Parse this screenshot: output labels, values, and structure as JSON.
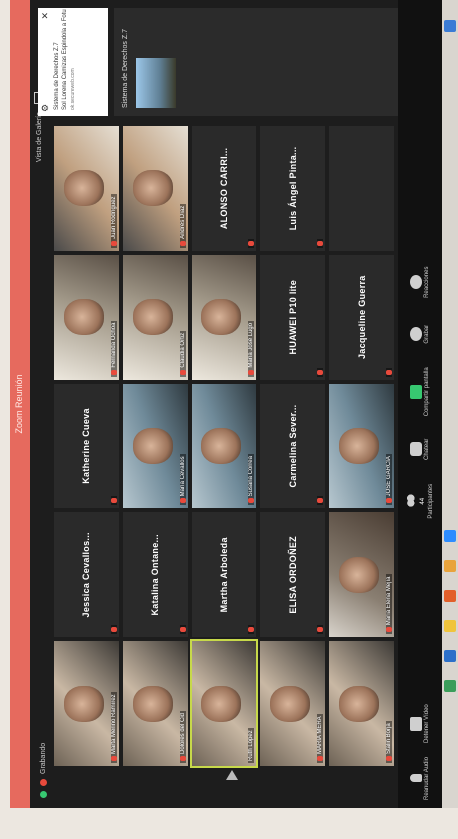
{
  "window": {
    "title": "Zoom Reunión"
  },
  "top": {
    "recording_label": "Grabando",
    "gallery_label": "Vista de Galería"
  },
  "participants": [
    {
      "name": "Marta Merino Ramírez",
      "type": "video",
      "muted": true
    },
    {
      "name": "Jessica Cevallos...",
      "type": "name",
      "muted": true
    },
    {
      "name": "Katherine Cueva",
      "type": "name",
      "muted": true
    },
    {
      "name": "Fernanda Ochoa",
      "type": "video",
      "muted": true
    },
    {
      "name": "Juan Rodríguez",
      "type": "video",
      "muted": true
    },
    {
      "name": "Dolores del Cid",
      "type": "video",
      "muted": true
    },
    {
      "name": "Katalina Ontane...",
      "type": "name",
      "muted": true
    },
    {
      "name": "María Cevallos",
      "type": "video",
      "muted": true
    },
    {
      "name": "Claudia Ortiz",
      "type": "video",
      "muted": true
    },
    {
      "name": "Andrés Díaz",
      "type": "video",
      "muted": true
    },
    {
      "name": "Ruth López",
      "type": "video",
      "muted": false,
      "active": true
    },
    {
      "name": "Martha Arboleda",
      "type": "name",
      "muted": true
    },
    {
      "name": "Susana Correa",
      "type": "video",
      "muted": true
    },
    {
      "name": "María José Lugo",
      "type": "video",
      "muted": true
    },
    {
      "name": "ALONSO CARRI...",
      "type": "name",
      "muted": true
    },
    {
      "name": "MARÍA MERA",
      "type": "video",
      "muted": true
    },
    {
      "name": "ELISA ORDOÑEZ",
      "type": "name",
      "muted": true
    },
    {
      "name": "Carmelina Sever...",
      "type": "name",
      "muted": true
    },
    {
      "name": "HUAWEI P10 lite",
      "type": "name",
      "muted": true
    },
    {
      "name": "Luis Ángel Pinta...",
      "type": "name",
      "muted": true
    },
    {
      "name": "Stalin Borja",
      "type": "video",
      "muted": true
    },
    {
      "name": "María Elena Mejía",
      "type": "video",
      "muted": true
    },
    {
      "name": "JOSÉ GARCÍA",
      "type": "video",
      "muted": true
    },
    {
      "name": "Jacqueline Guerra",
      "type": "name",
      "muted": true
    },
    {
      "name": "",
      "type": "empty",
      "muted": false
    }
  ],
  "notification": {
    "line1": "Sistema de Derechos Z.7",
    "line2": "Sol Lorena Camizas Espindola a Fotu",
    "line3": "ok.secureweb.com"
  },
  "chat": {
    "title": "Sistema de Derechos Z.7"
  },
  "toolbar": {
    "audio": "Reanudar Audio",
    "video": "Detener Vídeo",
    "participants": "Participantes",
    "participant_count": "44",
    "chat": "Chatear",
    "share": "Compartir pantalla",
    "record": "Grabar",
    "reactions": "Reacciones"
  }
}
